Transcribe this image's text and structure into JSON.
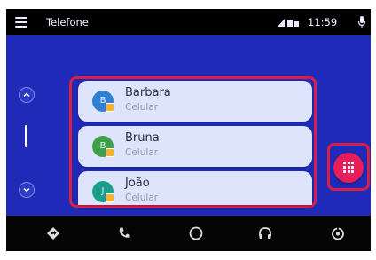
{
  "status": {
    "title": "Telefone",
    "time": "11:59",
    "icons": [
      "menu-icon",
      "signal-icon",
      "battery-icon",
      "microphone-icon"
    ]
  },
  "contacts": [
    {
      "name": "Barbara",
      "type": "Celular",
      "avatar_color": "#2f7fd3",
      "avatar_letter": "B"
    },
    {
      "name": "Bruna",
      "type": "Celular",
      "avatar_color": "#3f9f49",
      "avatar_letter": "B"
    },
    {
      "name": "João",
      "type": "Celular",
      "avatar_color": "#1b9e8b",
      "avatar_letter": "J"
    }
  ],
  "nav": {
    "items": [
      "navigation-icon",
      "phone-icon",
      "home-icon",
      "headphones-icon",
      "recents-icon"
    ]
  },
  "colors": {
    "background": "#1f2bb8",
    "card": "#dde4fb",
    "highlight": "#d91e43",
    "dialpad": "#e81d5c"
  }
}
